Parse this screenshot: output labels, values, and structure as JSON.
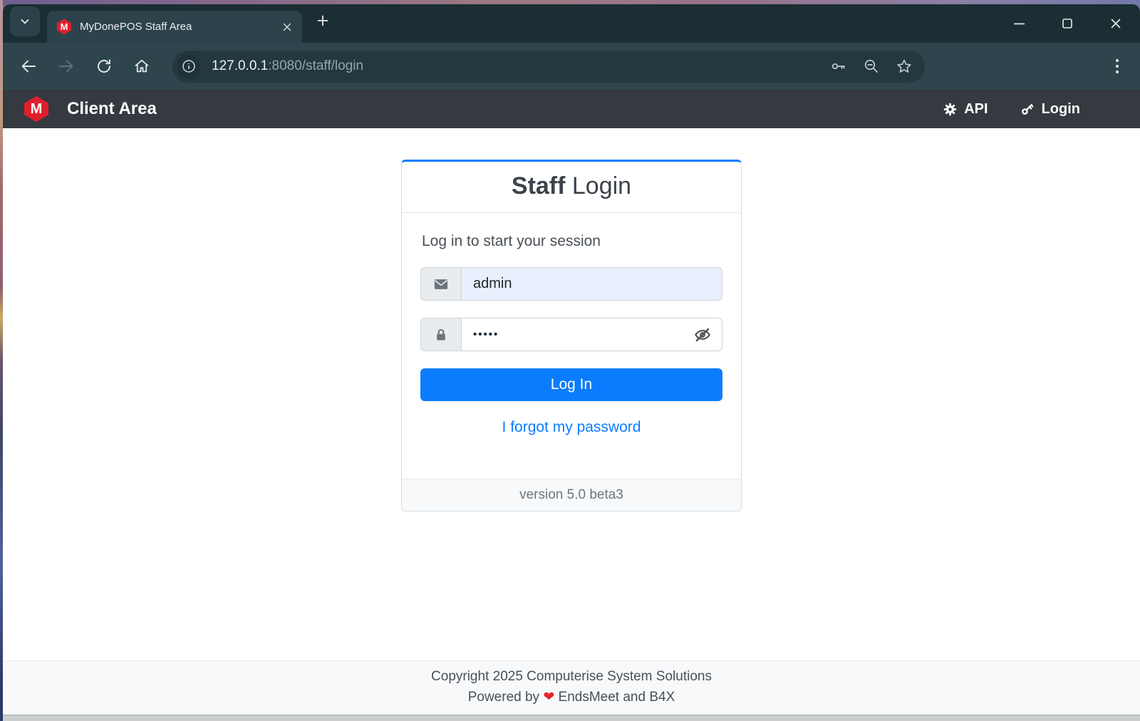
{
  "browser": {
    "tab_title": "MyDonePOS Staff Area",
    "favicon_letter": "M",
    "url_host": "127.0.0.1",
    "url_path": ":8080/staff/login"
  },
  "site_navbar": {
    "logo_letter": "M",
    "brand": "Client Area",
    "links": [
      {
        "label": "API",
        "icon": "gear-icon"
      },
      {
        "label": "Login",
        "icon": "key-icon"
      }
    ]
  },
  "login_card": {
    "title_bold": "Staff",
    "title_light": " Login",
    "subtitle": "Log in to start your session",
    "username": {
      "value": "admin",
      "icon": "envelope-icon"
    },
    "password": {
      "masked_value": "•••••",
      "icon": "lock-icon",
      "toggle_icon": "eye-slash-icon"
    },
    "submit_label": "Log In",
    "forgot_link": "I forgot my password",
    "version": "version 5.0 beta3"
  },
  "page_footer": {
    "copyright": "Copyright 2025 Computerise System Solutions",
    "powered_prefix": "Powered by ",
    "heart": "❤",
    "powered_suffix": " EndsMeet and B4X"
  },
  "colors": {
    "primary_blue": "#0b7cfd",
    "navbar_bg": "#343a40",
    "logo_red": "#e01f2d",
    "heart_red": "#e8212e",
    "browser_chrome_dark": "#1b2e34",
    "browser_chrome": "#2e454d",
    "autofill_bg": "#e8f0fe"
  }
}
